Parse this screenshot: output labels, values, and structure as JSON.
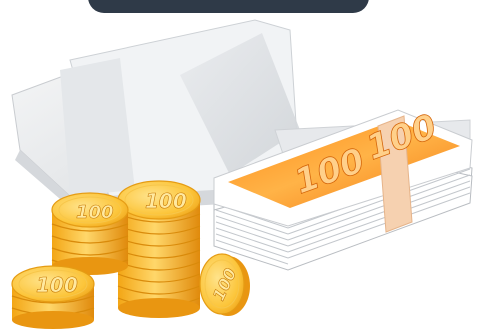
{
  "scene": {
    "description_free": true,
    "banner": {
      "color": "#2f3a48"
    },
    "banknote_stack": {
      "label": "100",
      "color": "#f39a1c",
      "band_color": "#f6d1b0"
    },
    "coins": {
      "label": "100",
      "color": "#f5b81f"
    },
    "folder": {
      "color": "#eceef0"
    }
  }
}
